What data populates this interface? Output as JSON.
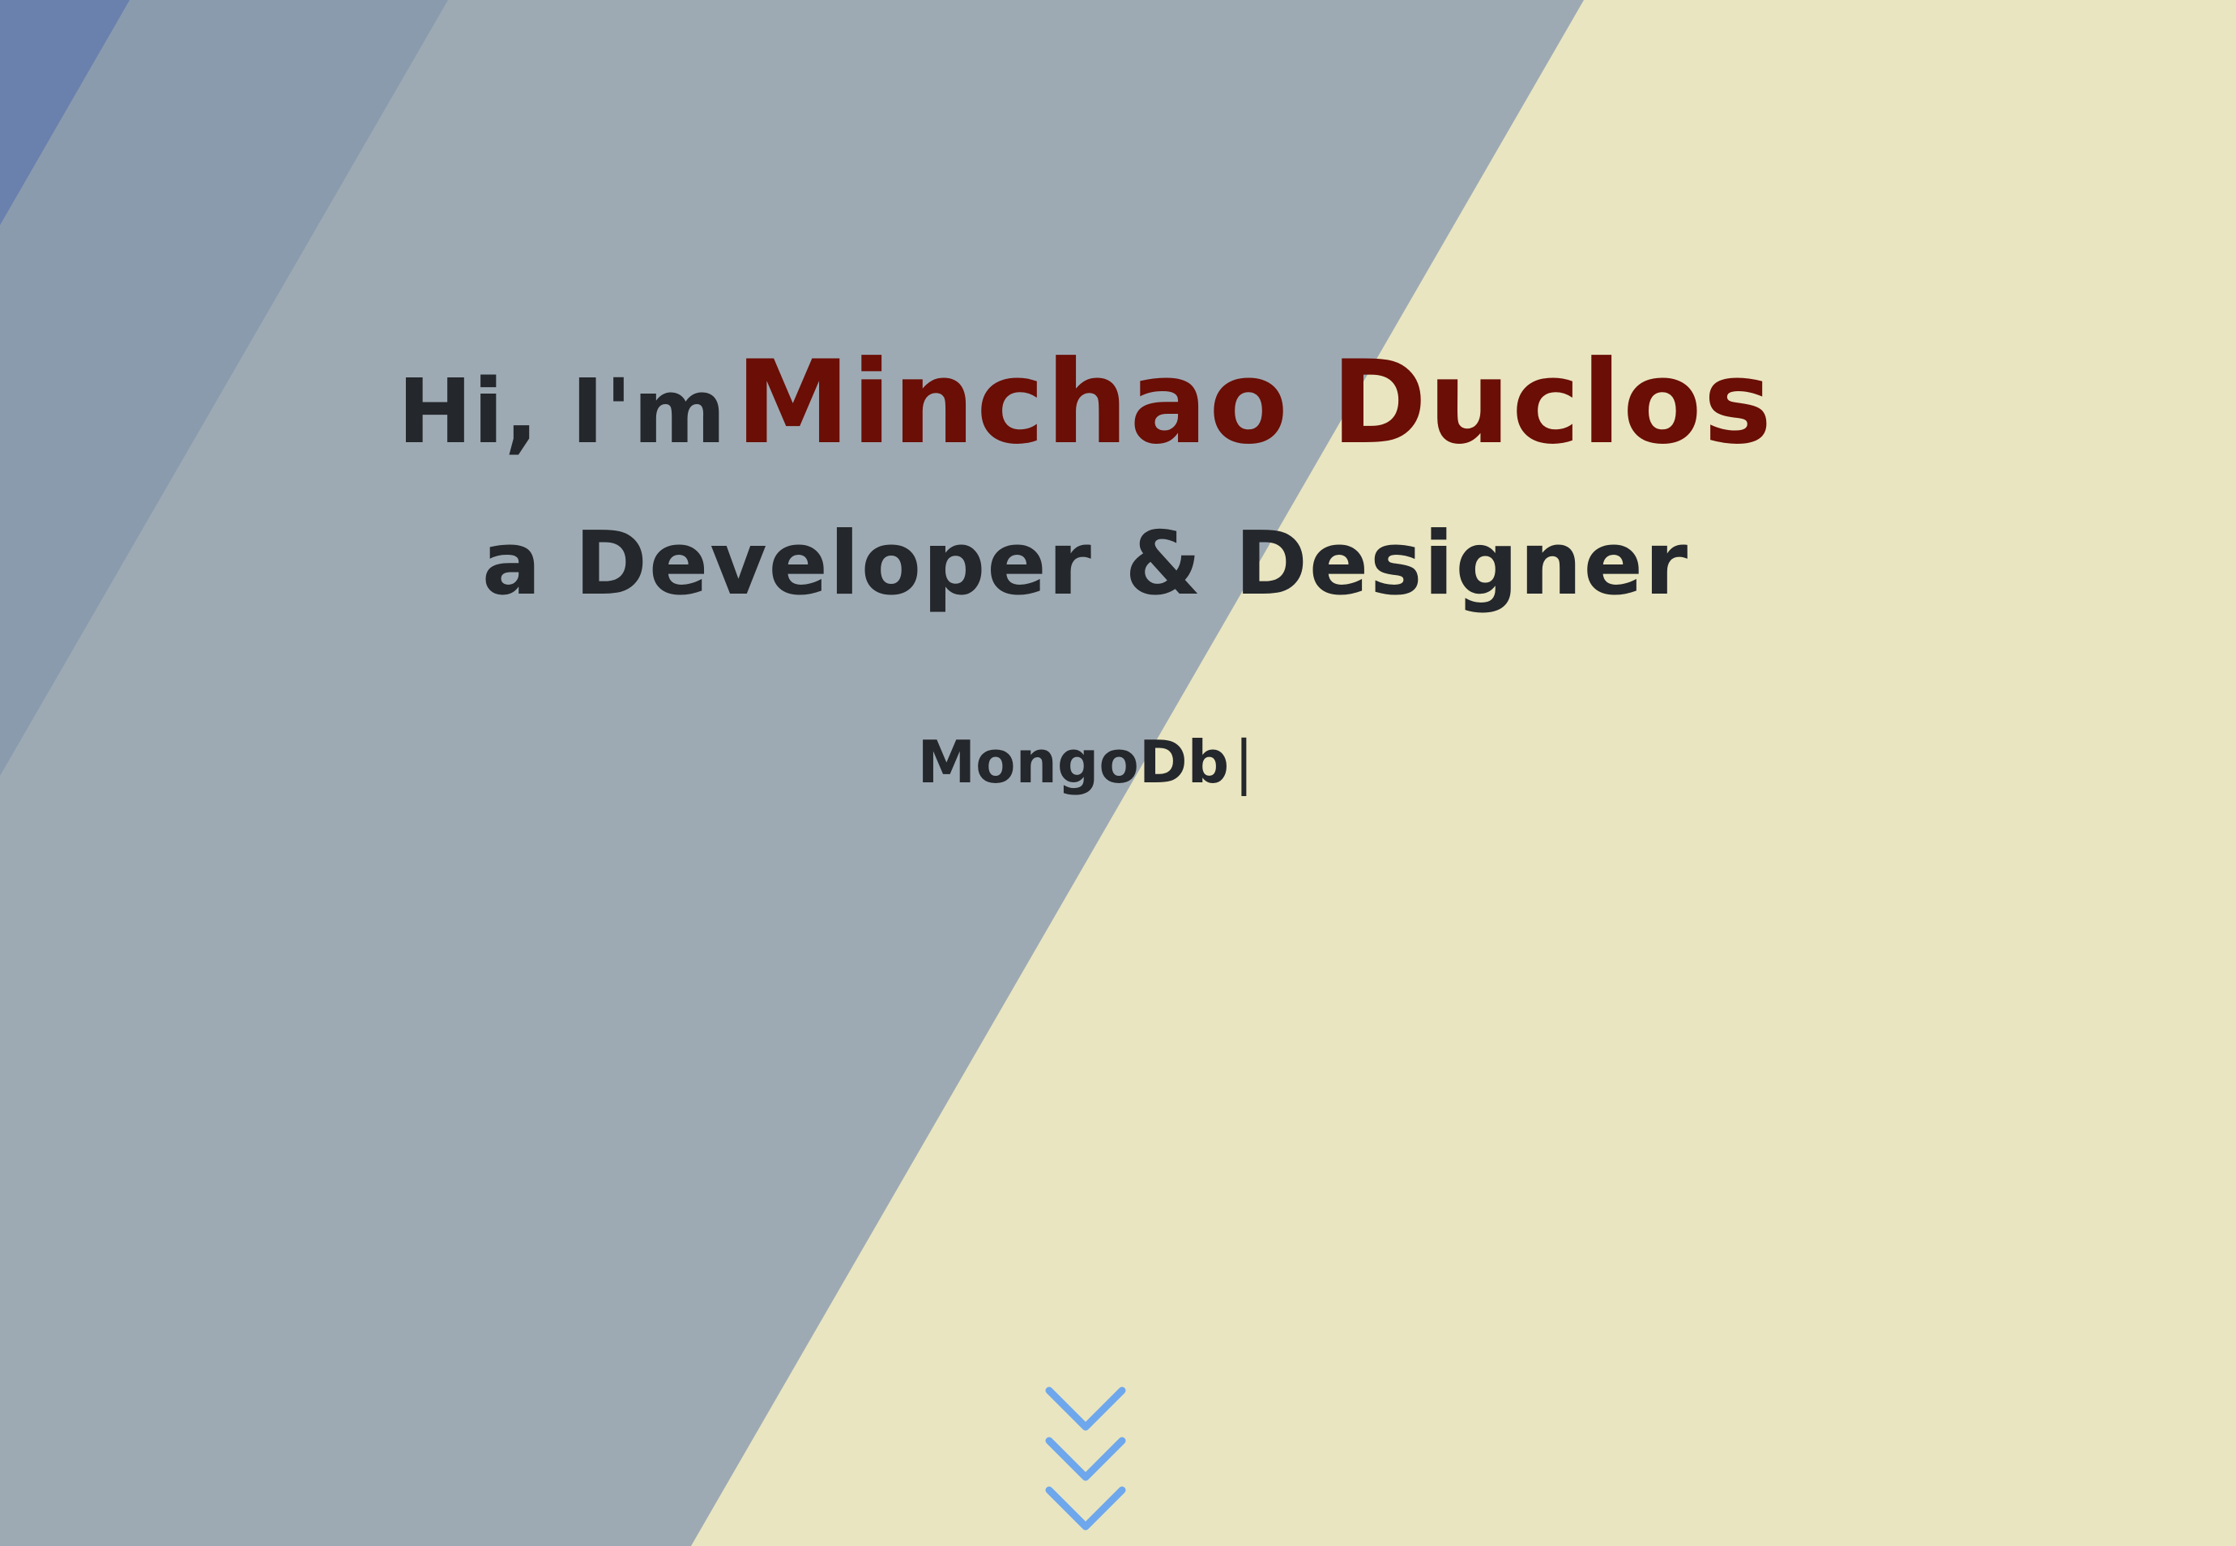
{
  "hero": {
    "greeting_prefix": "Hi, I'm",
    "name": "Minchao Duclos",
    "tagline": "a Developer & Designer",
    "typed_text": "MongoDb",
    "typed_cursor": "|"
  },
  "scroll_down": {
    "icon": "chevron-down-triple-icon"
  },
  "colors": {
    "name_accent": "#6a0e06",
    "text_dark": "#24272b",
    "background_cream": "#e9e5c0",
    "background_slate": "#9eaab3",
    "background_steel": "#8a9bae",
    "background_blue": "#6a80ad",
    "chevron_blue": "#6ea7ec"
  }
}
